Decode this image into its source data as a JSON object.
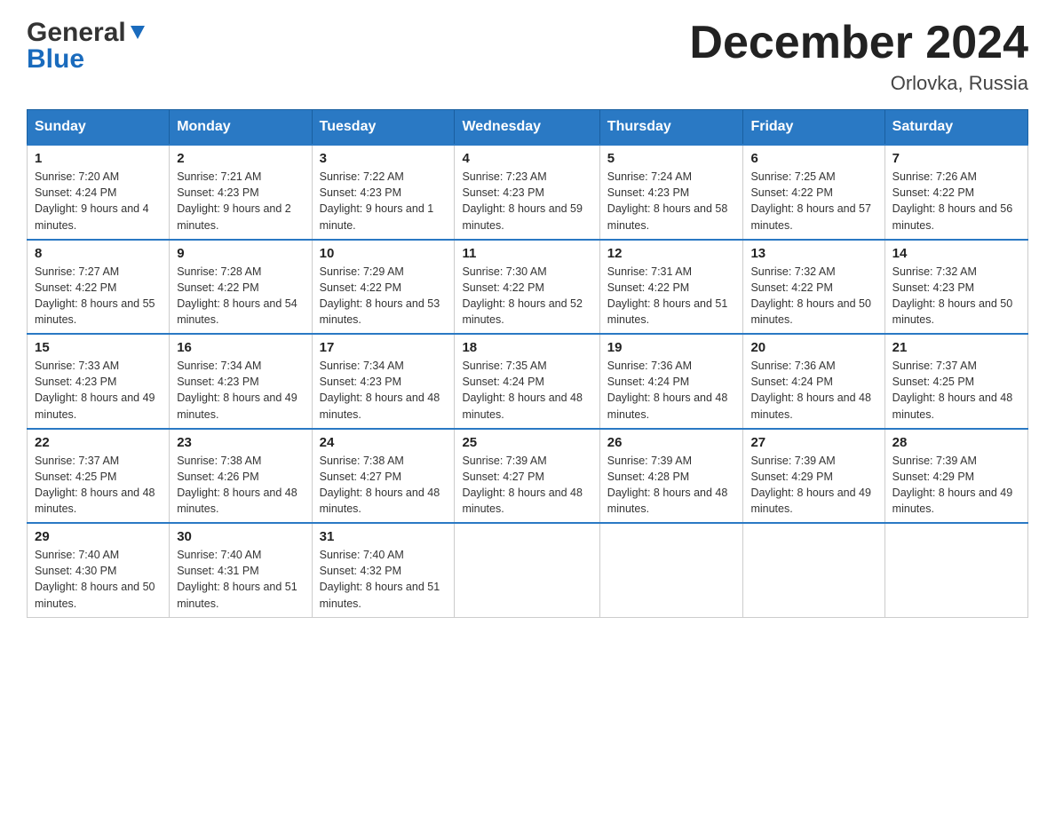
{
  "header": {
    "logo_general": "General",
    "logo_blue": "Blue",
    "month_title": "December 2024",
    "location": "Orlovka, Russia"
  },
  "weekdays": [
    "Sunday",
    "Monday",
    "Tuesday",
    "Wednesday",
    "Thursday",
    "Friday",
    "Saturday"
  ],
  "weeks": [
    [
      {
        "day": "1",
        "sunrise": "7:20 AM",
        "sunset": "4:24 PM",
        "daylight": "9 hours and 4 minutes."
      },
      {
        "day": "2",
        "sunrise": "7:21 AM",
        "sunset": "4:23 PM",
        "daylight": "9 hours and 2 minutes."
      },
      {
        "day": "3",
        "sunrise": "7:22 AM",
        "sunset": "4:23 PM",
        "daylight": "9 hours and 1 minute."
      },
      {
        "day": "4",
        "sunrise": "7:23 AM",
        "sunset": "4:23 PM",
        "daylight": "8 hours and 59 minutes."
      },
      {
        "day": "5",
        "sunrise": "7:24 AM",
        "sunset": "4:23 PM",
        "daylight": "8 hours and 58 minutes."
      },
      {
        "day": "6",
        "sunrise": "7:25 AM",
        "sunset": "4:22 PM",
        "daylight": "8 hours and 57 minutes."
      },
      {
        "day": "7",
        "sunrise": "7:26 AM",
        "sunset": "4:22 PM",
        "daylight": "8 hours and 56 minutes."
      }
    ],
    [
      {
        "day": "8",
        "sunrise": "7:27 AM",
        "sunset": "4:22 PM",
        "daylight": "8 hours and 55 minutes."
      },
      {
        "day": "9",
        "sunrise": "7:28 AM",
        "sunset": "4:22 PM",
        "daylight": "8 hours and 54 minutes."
      },
      {
        "day": "10",
        "sunrise": "7:29 AM",
        "sunset": "4:22 PM",
        "daylight": "8 hours and 53 minutes."
      },
      {
        "day": "11",
        "sunrise": "7:30 AM",
        "sunset": "4:22 PM",
        "daylight": "8 hours and 52 minutes."
      },
      {
        "day": "12",
        "sunrise": "7:31 AM",
        "sunset": "4:22 PM",
        "daylight": "8 hours and 51 minutes."
      },
      {
        "day": "13",
        "sunrise": "7:32 AM",
        "sunset": "4:22 PM",
        "daylight": "8 hours and 50 minutes."
      },
      {
        "day": "14",
        "sunrise": "7:32 AM",
        "sunset": "4:23 PM",
        "daylight": "8 hours and 50 minutes."
      }
    ],
    [
      {
        "day": "15",
        "sunrise": "7:33 AM",
        "sunset": "4:23 PM",
        "daylight": "8 hours and 49 minutes."
      },
      {
        "day": "16",
        "sunrise": "7:34 AM",
        "sunset": "4:23 PM",
        "daylight": "8 hours and 49 minutes."
      },
      {
        "day": "17",
        "sunrise": "7:34 AM",
        "sunset": "4:23 PM",
        "daylight": "8 hours and 48 minutes."
      },
      {
        "day": "18",
        "sunrise": "7:35 AM",
        "sunset": "4:24 PM",
        "daylight": "8 hours and 48 minutes."
      },
      {
        "day": "19",
        "sunrise": "7:36 AM",
        "sunset": "4:24 PM",
        "daylight": "8 hours and 48 minutes."
      },
      {
        "day": "20",
        "sunrise": "7:36 AM",
        "sunset": "4:24 PM",
        "daylight": "8 hours and 48 minutes."
      },
      {
        "day": "21",
        "sunrise": "7:37 AM",
        "sunset": "4:25 PM",
        "daylight": "8 hours and 48 minutes."
      }
    ],
    [
      {
        "day": "22",
        "sunrise": "7:37 AM",
        "sunset": "4:25 PM",
        "daylight": "8 hours and 48 minutes."
      },
      {
        "day": "23",
        "sunrise": "7:38 AM",
        "sunset": "4:26 PM",
        "daylight": "8 hours and 48 minutes."
      },
      {
        "day": "24",
        "sunrise": "7:38 AM",
        "sunset": "4:27 PM",
        "daylight": "8 hours and 48 minutes."
      },
      {
        "day": "25",
        "sunrise": "7:39 AM",
        "sunset": "4:27 PM",
        "daylight": "8 hours and 48 minutes."
      },
      {
        "day": "26",
        "sunrise": "7:39 AM",
        "sunset": "4:28 PM",
        "daylight": "8 hours and 48 minutes."
      },
      {
        "day": "27",
        "sunrise": "7:39 AM",
        "sunset": "4:29 PM",
        "daylight": "8 hours and 49 minutes."
      },
      {
        "day": "28",
        "sunrise": "7:39 AM",
        "sunset": "4:29 PM",
        "daylight": "8 hours and 49 minutes."
      }
    ],
    [
      {
        "day": "29",
        "sunrise": "7:40 AM",
        "sunset": "4:30 PM",
        "daylight": "8 hours and 50 minutes."
      },
      {
        "day": "30",
        "sunrise": "7:40 AM",
        "sunset": "4:31 PM",
        "daylight": "8 hours and 51 minutes."
      },
      {
        "day": "31",
        "sunrise": "7:40 AM",
        "sunset": "4:32 PM",
        "daylight": "8 hours and 51 minutes."
      },
      null,
      null,
      null,
      null
    ]
  ]
}
